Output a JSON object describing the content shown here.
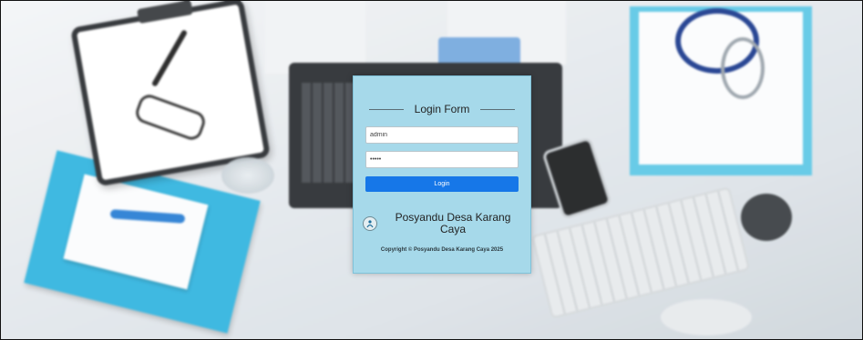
{
  "login_form": {
    "title": "Login Form",
    "username_value": "admin",
    "password_value": "•••••",
    "login_label": "Login"
  },
  "brand": {
    "logo_icon": "posyandu-logo-icon",
    "name_line1": "Posyandu Desa Karang",
    "name_line2": "Caya"
  },
  "footer": {
    "copyright": "Copyright © Posyandu Desa Karang Caya 2025"
  },
  "colors": {
    "panel_bg": "#a6d9ea",
    "button_bg": "#1677e8"
  }
}
